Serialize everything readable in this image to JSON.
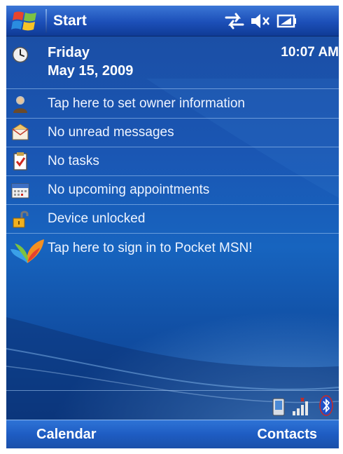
{
  "title_bar": {
    "start_label": "Start",
    "icons": [
      "windows-flag-icon",
      "connectivity-icon",
      "speaker-muted-icon",
      "battery-icon"
    ]
  },
  "today": {
    "date": {
      "day": "Friday",
      "date": "May 15, 2009",
      "time": "10:07 AM"
    },
    "items": [
      {
        "icon": "owner-icon",
        "label": "Tap here to set owner information"
      },
      {
        "icon": "messages-icon",
        "label": "No unread messages"
      },
      {
        "icon": "tasks-icon",
        "label": "No tasks"
      },
      {
        "icon": "calendar-icon",
        "label": "No upcoming appointments"
      },
      {
        "icon": "lock-icon",
        "label": "Device unlocked"
      },
      {
        "icon": "msn-butterfly-icon",
        "label": "Tap here to sign in to Pocket MSN!"
      }
    ],
    "tray_icons": [
      "device-icon",
      "signal-icon",
      "bluetooth-icon"
    ]
  },
  "softkeys": {
    "left": "Calendar",
    "right": "Contacts"
  },
  "colors": {
    "title_bar": "#1c4fb8",
    "background": "#1a56b3",
    "softkey_bar": "#1e5cc2",
    "text": "#ffffff"
  }
}
